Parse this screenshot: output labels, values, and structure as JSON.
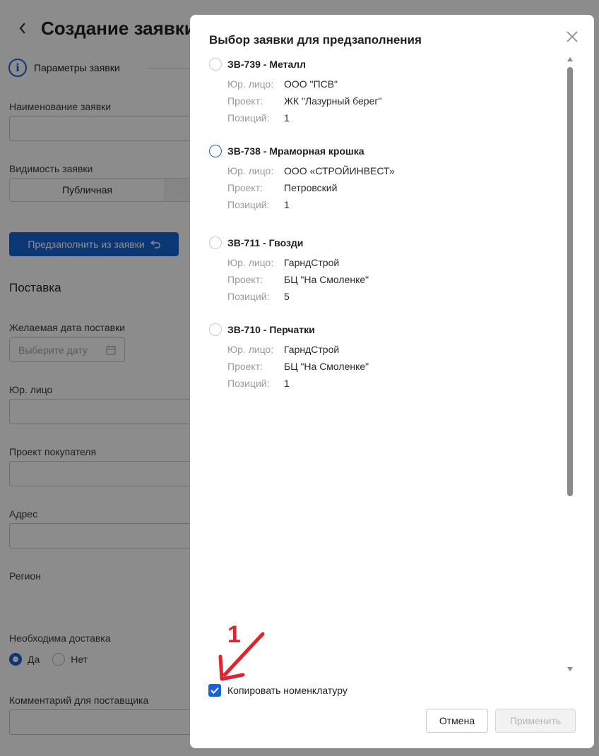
{
  "page": {
    "title": "Создание заявки",
    "step_label": "Параметры заявки",
    "fields": {
      "name_label": "Наименование заявки",
      "visibility_label": "Видимость заявки",
      "visibility_selected": "Публичная",
      "prefill_button": "Предзаполнить из заявки",
      "delivery_section": "Поставка",
      "date_label": "Желаемая дата поставки",
      "date_placeholder": "Выберите дату",
      "legal_entity_label": "Юр. лицо",
      "project_label": "Проект покупателя",
      "address_label": "Адрес",
      "region_label": "Регион",
      "delivery_needed_label": "Необходима доставка",
      "yes": "Да",
      "no": "Нет",
      "comment_label": "Комментарий для поставщика"
    }
  },
  "modal": {
    "title": "Выбор заявки для предзаполнения",
    "prop_labels": {
      "legal": "Юр. лицо:",
      "project": "Проект:",
      "positions": "Позиций:"
    },
    "items": [
      {
        "title": "ЗВ-739 - Металл",
        "legal": "ООО \"ПСВ\"",
        "project": "ЖК \"Лазурный берег\"",
        "positions": "1"
      },
      {
        "title": "ЗВ-738 - Мраморная крошка",
        "legal": "ООО «СТРОЙИНВЕСТ»",
        "project": "Петровский",
        "positions": "1"
      },
      {
        "title": "ЗВ-711 - Гвозди",
        "legal": "ГарндСтрой",
        "project": "БЦ \"На Смоленке\"",
        "positions": "5"
      },
      {
        "title": "ЗВ-710 - Перчатки",
        "legal": "ГарндСтрой",
        "project": "БЦ \"На Смоленке\"",
        "positions": "1"
      }
    ],
    "copy_nomenclature_label": "Копировать номенклатуру",
    "copy_nomenclature_checked": true,
    "cancel_label": "Отмена",
    "apply_label": "Применить"
  },
  "annotation": {
    "number": "1"
  },
  "colors": {
    "accent": "#1565d8",
    "annotation": "#e0242d"
  }
}
